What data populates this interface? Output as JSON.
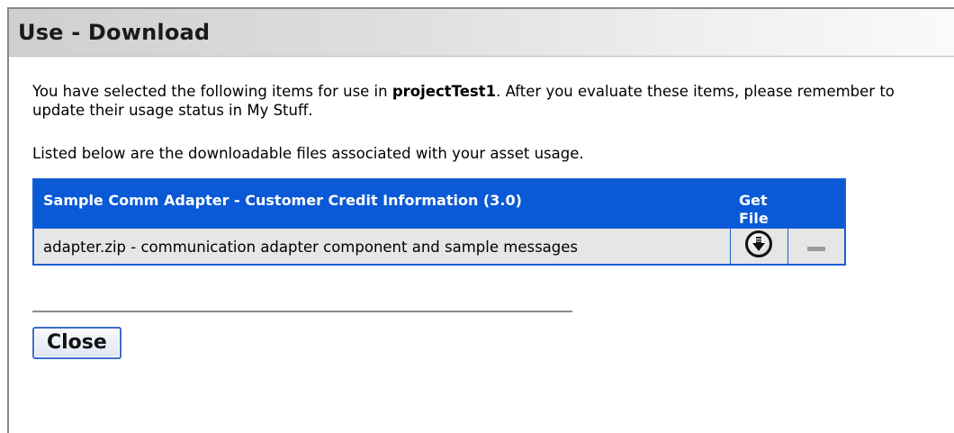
{
  "dialog": {
    "title": "Use - Download",
    "intro_before": "You have selected the following items for use in ",
    "project_name": "projectTest1",
    "intro_after": ". After you evaluate these items, please remember to update their usage status in My Stuff.",
    "listed_text": "Listed below are the downloadable files associated with your asset usage."
  },
  "table": {
    "header_asset": "Sample Comm Adapter - Customer Credit Information (3.0)",
    "header_get_file": "Get File",
    "rows": [
      {
        "file_description": "adapter.zip - communication adapter component and sample messages",
        "download_icon": "download-circle-icon",
        "extra_icon": "minus-icon"
      }
    ]
  },
  "buttons": {
    "close_label": "Close"
  },
  "colors": {
    "header_blue": "#0a59d6",
    "row_gray": "#e6e6e6"
  }
}
